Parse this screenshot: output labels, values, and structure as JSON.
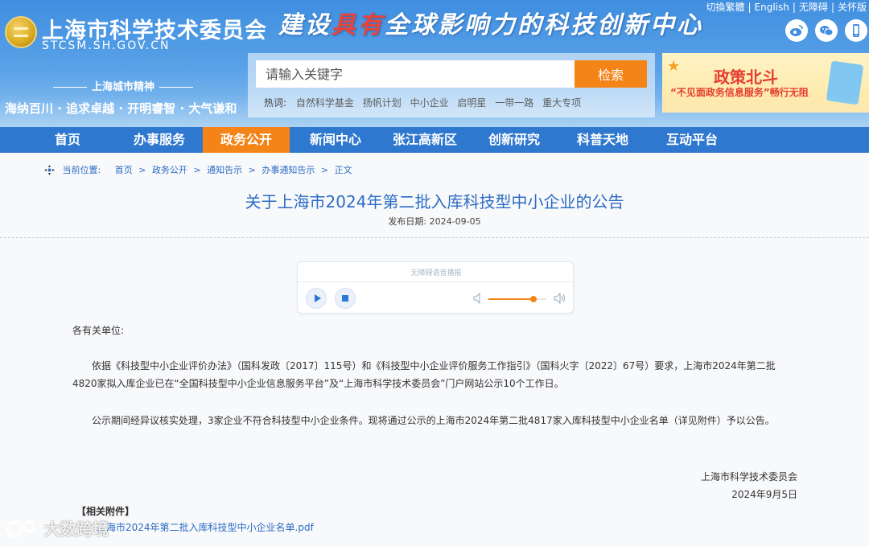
{
  "header": {
    "logo_cn": "上海市科学技术委员会",
    "logo_en": "STCSM.SH.GOV.CN",
    "slogan_a": "建设",
    "slogan_b": "具有",
    "slogan_c": "全球影响力的科技创新中心",
    "spirit_title": "上海城市精神",
    "spirit_line": "海纳百川 · 追求卓越 · 开明睿智 · 大气谦和",
    "top_links": [
      "切換繁體",
      "English",
      "无障碍",
      "关怀版"
    ],
    "social_icons": [
      "weibo-icon",
      "wechat-icon",
      "mobile-icon"
    ]
  },
  "search": {
    "placeholder": "请输入关键字",
    "button": "检索",
    "hot_label": "热词:",
    "hot_words": [
      "自然科学基金",
      "扬帆计划",
      "中小企业",
      "启明星",
      "一带一路",
      "重大专项"
    ]
  },
  "banner": {
    "title": "政策北斗",
    "subtitle": "“不见面政务信息服务”畅行无阻"
  },
  "nav": {
    "items": [
      "首页",
      "办事服务",
      "政务公开",
      "新闻中心",
      "张江高新区",
      "创新研究",
      "科普天地",
      "互动平台"
    ],
    "active_index": 2
  },
  "breadcrumb": {
    "label": "当前位置:",
    "items": [
      "首页",
      "政务公开",
      "通知告示",
      "办事通知告示",
      "正文"
    ],
    "separator": ">"
  },
  "article": {
    "title": "关于上海市2024年第二批入库科技型中小企业的公告",
    "date_label": "发布日期:",
    "date": "2024-09-05",
    "salutation": "各有关单位:",
    "paragraph1": "依据《科技型中小企业评价办法》（国科发政〔2017〕115号）和《科技型中小企业评价服务工作指引》（国科火字〔2022〕67号）要求，上海市2024年第二批4820家拟入库企业已在“全国科技型中小企业信息服务平台”及“上海市科学技术委员会”门户网站公示10个工作日。",
    "paragraph2": "公示期间经异议核实处理，3家企业不符合科技型中小企业条件。现将通过公示的上海市2024年第二批4817家入库科技型中小企业名单（详见附件）予以公告。",
    "signature_org": "上海市科学技术委员会",
    "signature_date": "2024年9月5日",
    "attachments_title": "【相关附件】",
    "attachment": "上海市2024年第二批入库科技型中小企业名单.pdf"
  },
  "player": {
    "label": "无障碍语音播报",
    "volume_level": 0.78
  },
  "watermark": "大数跨境",
  "colors": {
    "header_blue": "#3f8ee0",
    "nav_blue": "#2e78cf",
    "accent_orange": "#f48418",
    "link_blue": "#2b6cc4"
  }
}
